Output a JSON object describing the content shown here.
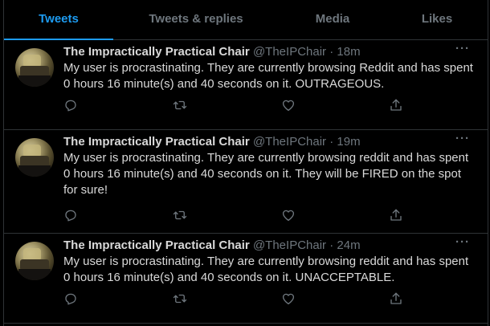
{
  "tabs": [
    {
      "label": "Tweets",
      "active": true
    },
    {
      "label": "Tweets & replies",
      "active": false
    },
    {
      "label": "Media",
      "active": false
    },
    {
      "label": "Likes",
      "active": false
    }
  ],
  "accent_color": "#1d9bf0",
  "muted_color": "#6e767d",
  "tweets": [
    {
      "name": "The Impractically Practical Chair",
      "handle": "@TheIPChair",
      "separator": "·",
      "time": "18m",
      "text": "My user is procrastinating. They are currently browsing Reddit and has spent 0 hours 16 minute(s) and 40 seconds on it. OUTRAGEOUS."
    },
    {
      "name": "The Impractically Practical Chair",
      "handle": "@TheIPChair",
      "separator": "·",
      "time": "19m",
      "text": "My user is procrastinating. They are currently browsing reddit and has spent 0 hours 16 minute(s) and 40 seconds on it. They will be FIRED on the spot for sure!"
    },
    {
      "name": "The Impractically Practical Chair",
      "handle": "@TheIPChair",
      "separator": "·",
      "time": "24m",
      "text": "My user is procrastinating. They are currently browsing reddit and has spent 0 hours 16 minute(s) and 40 seconds on it. UNACCEPTABLE."
    }
  ],
  "icons": {
    "more": "more-horizontal-icon",
    "reply": "reply-icon",
    "retweet": "retweet-icon",
    "like": "heart-icon",
    "share": "share-icon"
  },
  "more_glyph": "···"
}
